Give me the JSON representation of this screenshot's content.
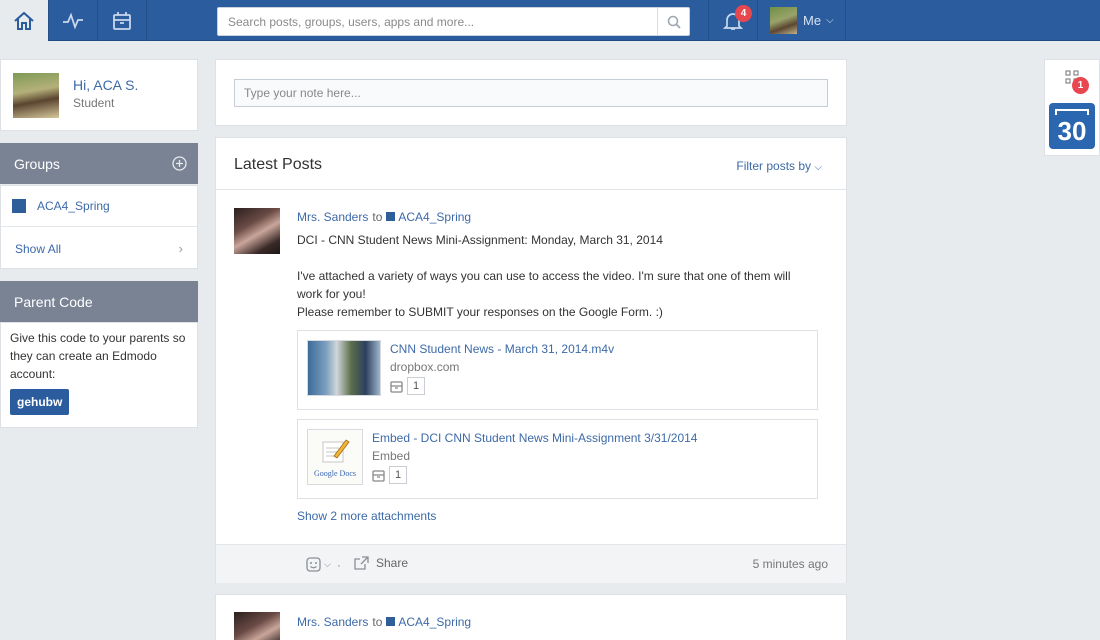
{
  "topbar": {
    "search_placeholder": "Search posts, groups, users, apps and more...",
    "notifications_count": "4",
    "user_label": "Me"
  },
  "profile": {
    "greeting": "Hi, ACA S.",
    "role": "Student"
  },
  "groups": {
    "title": "Groups",
    "items": [
      {
        "label": "ACA4_Spring",
        "color": "#2f5f9a"
      }
    ],
    "show_all": "Show All"
  },
  "parent_code": {
    "title": "Parent Code",
    "description": "Give this code to your parents so they can create an Edmodo account:",
    "code": "gehubw"
  },
  "note": {
    "placeholder": "Type your note here..."
  },
  "feed": {
    "title": "Latest Posts",
    "filter_label": "Filter posts by",
    "posts": [
      {
        "author": "Mrs. Sanders",
        "to_word": "to",
        "group": "ACA4_Spring",
        "title_line": "DCI - CNN Student News Mini-Assignment: Monday, March 31, 2014",
        "body_1": "I've attached a variety of ways you can use to access the video. I'm sure that one of them will work for you!",
        "body_2": "Please remember to SUBMIT your responses on the Google Form. :)",
        "attachments": [
          {
            "title": "CNN Student News - March 31, 2014.m4v",
            "source": "dropbox.com",
            "count": "1"
          },
          {
            "title": "Embed - DCI CNN Student News Mini-Assignment 3/31/2014",
            "source": "Embed",
            "count": "1",
            "thumb_text": "Google Docs"
          }
        ],
        "more_attachments": "Show 2 more attachments",
        "share_label": "Share",
        "time": "5 minutes ago"
      },
      {
        "author": "Mrs. Sanders",
        "to_word": "to",
        "group": "ACA4_Spring"
      }
    ]
  },
  "widget": {
    "apps_badge": "1",
    "calendar_day": "30"
  },
  "colors": {
    "brand": "#2b5c9e",
    "link": "#3d6aa8",
    "badge": "#e8474f",
    "section_header": "#7a8394"
  }
}
